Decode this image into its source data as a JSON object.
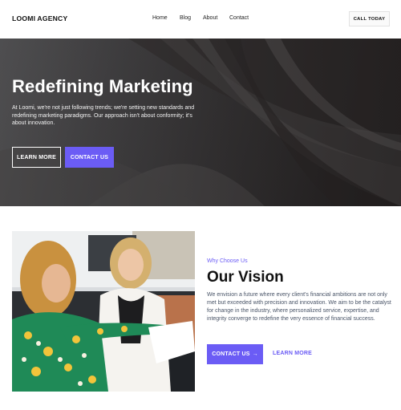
{
  "nav": {
    "logo": "LOOMI AGENCY",
    "links": [
      "Home",
      "Blog",
      "About",
      "Contact"
    ],
    "cta": "CALL TODAY"
  },
  "hero": {
    "title": "Redefining Marketing",
    "text": "At Loomi, we're not just following trends; we're setting new standards and redefining marketing paradigms. Our approach isn't about conformity; it's about innovation.",
    "button_primary": "LEARN MORE",
    "button_secondary": "CONTACT US"
  },
  "vision": {
    "eyebrow": "Why Choose Us",
    "title": "Our Vision",
    "text": "We envision a future where every client's financial ambitions are not only met but exceeded with precision and innovation. We aim to be the catalyst for change in the industry, where personalized service, expertise, and integrity converge to redefine the very essence of financial success.",
    "contact_button": "CONTACT US",
    "contact_arrow": "→",
    "learn_more": "LEARN MORE"
  },
  "colors": {
    "accent": "#6b5cf5",
    "hero_dark": "#2e2c2d",
    "body_text": "#4a5568"
  },
  "icons": {
    "contact_arrow": "arrow-right-icon"
  }
}
